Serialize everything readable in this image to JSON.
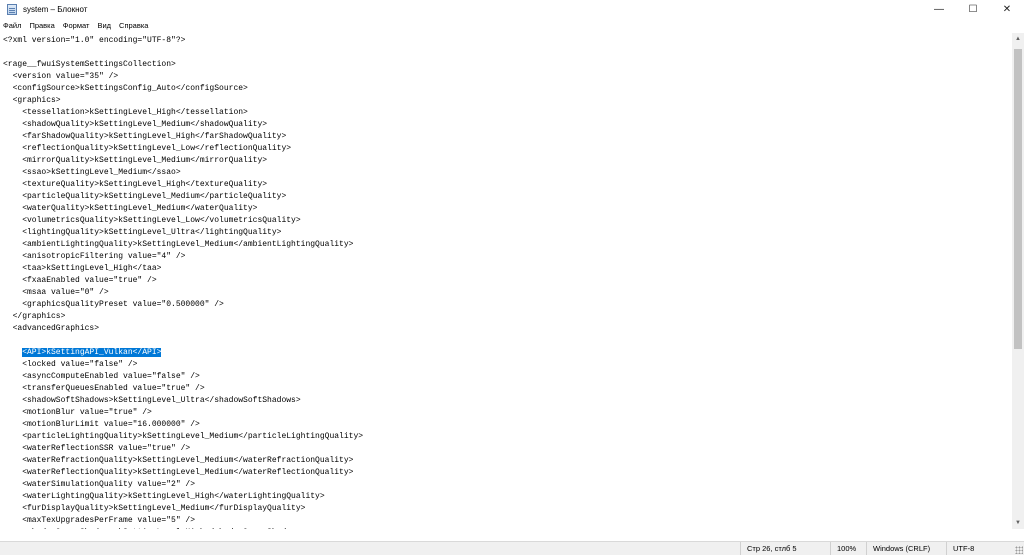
{
  "window": {
    "title": "system – Блокнот",
    "minimize_glyph": "—",
    "maximize_glyph": "☐",
    "close_glyph": "✕"
  },
  "menu": [
    "Файл",
    "Правка",
    "Формат",
    "Вид",
    "Справка"
  ],
  "editor": {
    "selected_line_index": 26,
    "selected_text": "<API>kSettingAPI_Vulkan</API>",
    "lines": [
      "<?xml version=\"1.0\" encoding=\"UTF-8\"?>",
      "",
      "<rage__fwuiSystemSettingsCollection>",
      "  <version value=\"35\" />",
      "  <configSource>kSettingsConfig_Auto</configSource>",
      "  <graphics>",
      "    <tessellation>kSettingLevel_High</tessellation>",
      "    <shadowQuality>kSettingLevel_Medium</shadowQuality>",
      "    <farShadowQuality>kSettingLevel_High</farShadowQuality>",
      "    <reflectionQuality>kSettingLevel_Low</reflectionQuality>",
      "    <mirrorQuality>kSettingLevel_Medium</mirrorQuality>",
      "    <ssao>kSettingLevel_Medium</ssao>",
      "    <textureQuality>kSettingLevel_High</textureQuality>",
      "    <particleQuality>kSettingLevel_Medium</particleQuality>",
      "    <waterQuality>kSettingLevel_Medium</waterQuality>",
      "    <volumetricsQuality>kSettingLevel_Low</volumetricsQuality>",
      "    <lightingQuality>kSettingLevel_Ultra</lightingQuality>",
      "    <ambientLightingQuality>kSettingLevel_Medium</ambientLightingQuality>",
      "    <anisotropicFiltering value=\"4\" />",
      "    <taa>kSettingLevel_High</taa>",
      "    <fxaaEnabled value=\"true\" />",
      "    <msaa value=\"0\" />",
      "    <graphicsQualityPreset value=\"0.500000\" />",
      "  </graphics>",
      "  <advancedGraphics>",
      "",
      "    <API>kSettingAPI_Vulkan</API>",
      "    <locked value=\"false\" />",
      "    <asyncComputeEnabled value=\"false\" />",
      "    <transferQueuesEnabled value=\"true\" />",
      "    <shadowSoftShadows>kSettingLevel_Ultra</shadowSoftShadows>",
      "    <motionBlur value=\"true\" />",
      "    <motionBlurLimit value=\"16.000000\" />",
      "    <particleLightingQuality>kSettingLevel_Medium</particleLightingQuality>",
      "    <waterReflectionSSR value=\"true\" />",
      "    <waterRefractionQuality>kSettingLevel_Medium</waterRefractionQuality>",
      "    <waterReflectionQuality>kSettingLevel_Medium</waterReflectionQuality>",
      "    <waterSimulationQuality value=\"2\" />",
      "    <waterLightingQuality>kSettingLevel_High</waterLightingQuality>",
      "    <furDisplayQuality>kSettingLevel_Medium</furDisplayQuality>",
      "    <maxTexUpgradesPerFrame value=\"5\" />",
      "    <shadowGrassShadows>kSettingLevel_High</shadowGrassShadows>"
    ]
  },
  "status": {
    "position": "Стр 26, стлб 5",
    "zoom": "100%",
    "line_endings": "Windows (CRLF)",
    "encoding": "UTF-8"
  }
}
